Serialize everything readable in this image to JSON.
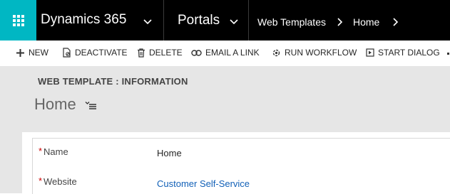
{
  "nav": {
    "app_name": "Dynamics 365",
    "area": "Portals",
    "breadcrumb_entity": "Web Templates",
    "breadcrumb_record": "Home"
  },
  "commands": [
    {
      "label": "NEW",
      "icon": "plus-icon"
    },
    {
      "label": "DEACTIVATE",
      "icon": "deactivate-icon"
    },
    {
      "label": "DELETE",
      "icon": "trash-icon"
    },
    {
      "label": "EMAIL A LINK",
      "icon": "link-icon"
    },
    {
      "label": "RUN WORKFLOW",
      "icon": "workflow-icon"
    },
    {
      "label": "START DIALOG",
      "icon": "dialog-icon"
    }
  ],
  "form": {
    "entity_label": "WEB TEMPLATE : INFORMATION",
    "record_title": "Home",
    "fields": [
      {
        "label": "Name",
        "value": "Home",
        "required": "*"
      },
      {
        "label": "Website",
        "value": "Customer Self-Service",
        "required": "*"
      }
    ]
  },
  "colors": {
    "nav_bg": "#000000",
    "waffle_bg": "#00b7c3",
    "header_bg": "#e6e6e6",
    "link": "#1160b7",
    "required": "#cc0000"
  }
}
